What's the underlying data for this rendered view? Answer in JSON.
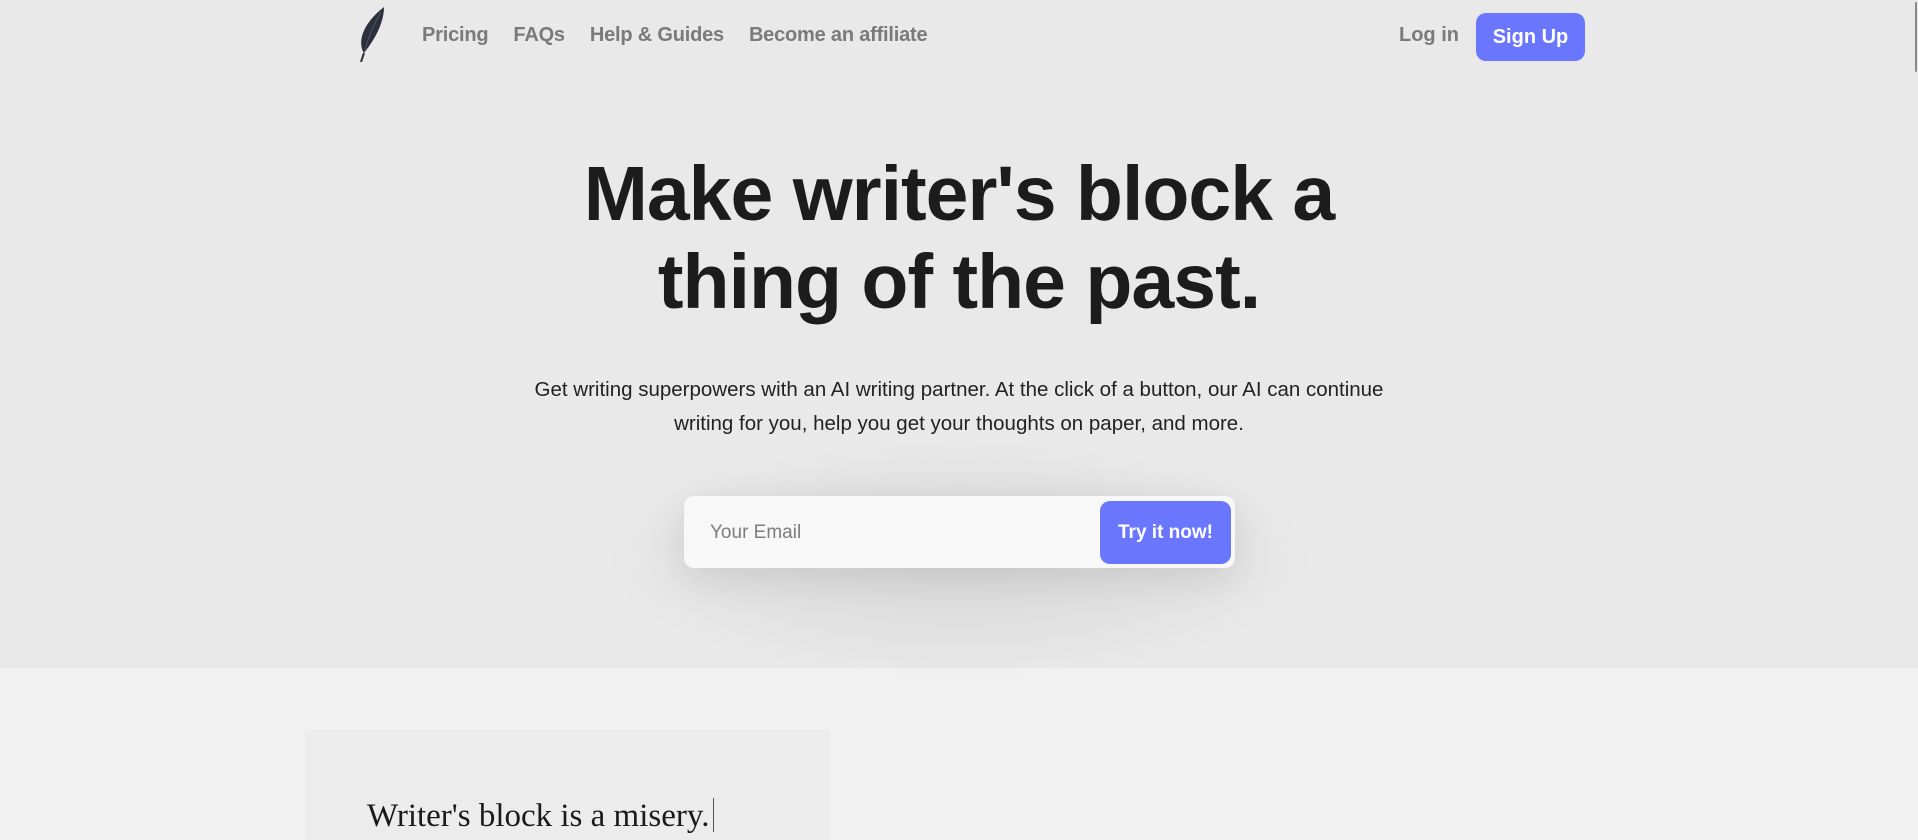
{
  "nav": {
    "logo_icon": "feather-icon",
    "links": [
      "Pricing",
      "FAQs",
      "Help & Guides",
      "Become an affiliate"
    ],
    "login_label": "Log in",
    "signup_label": "Sign Up"
  },
  "hero": {
    "headline_line1": "Make writer's block a",
    "headline_line2": "thing of the past.",
    "subtext_line1": "Get writing superpowers with an AI writing partner. At the click of a button, our AI can continue",
    "subtext_line2": "writing for you, help you get your thoughts on paper, and more.",
    "email_placeholder": "Your Email",
    "email_value": "",
    "cta_label": "Try it now!"
  },
  "demo": {
    "text": "Writer's block is a misery."
  },
  "colors": {
    "accent": "#6b76ff",
    "hero_bg": "#e9e9ea",
    "page_bg": "#f1f1f1"
  }
}
